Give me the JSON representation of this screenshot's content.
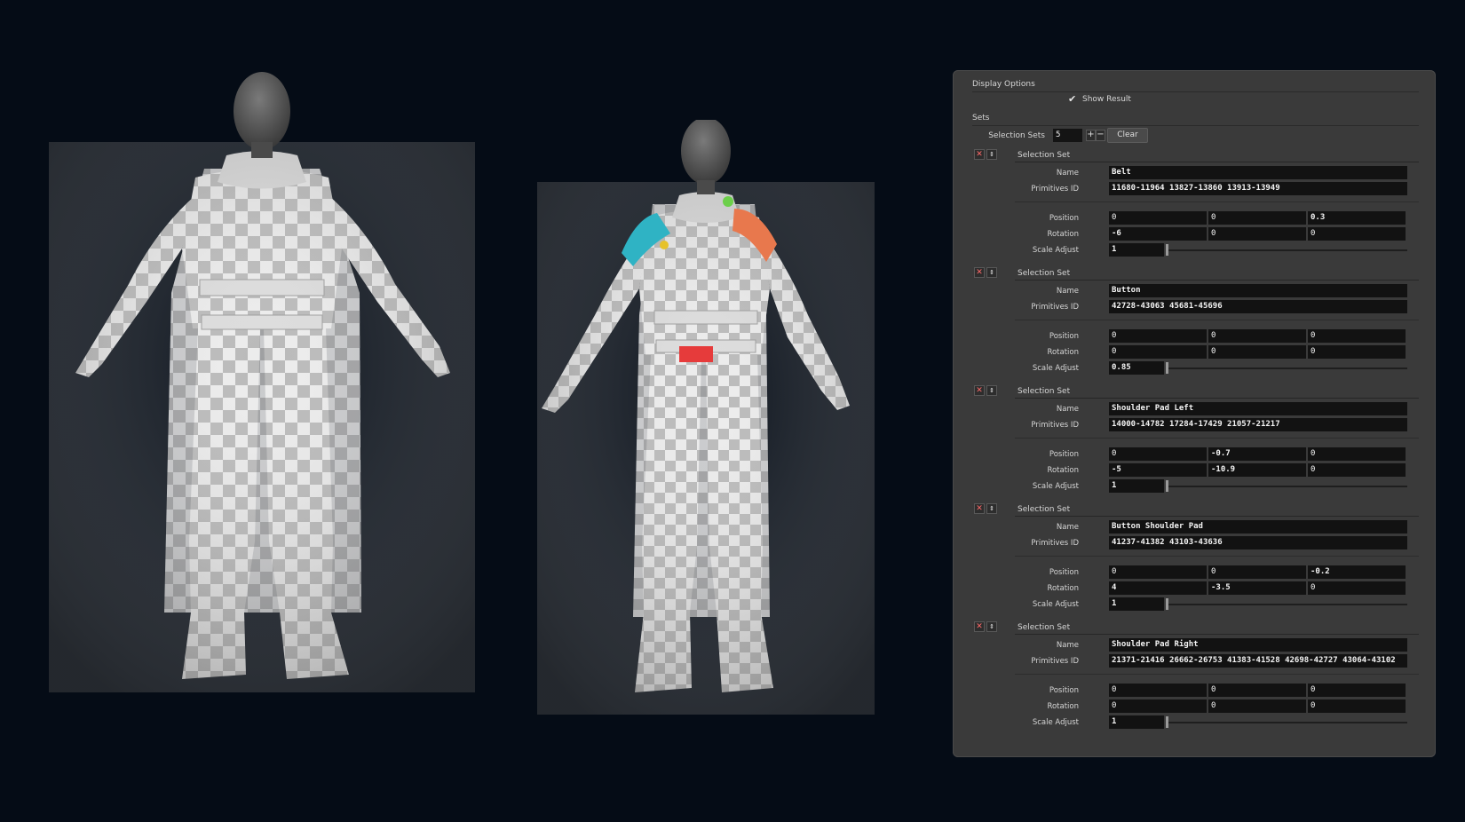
{
  "panel": {
    "display_options_label": "Display Options",
    "show_result_label": "Show Result",
    "show_result_checked": true,
    "sets_label": "Sets",
    "selection_sets_label": "Selection Sets",
    "selection_sets_count": "5",
    "plus_label": "+",
    "minus_label": "−",
    "clear_label": "Clear",
    "labels": {
      "selection_set": "Selection Set",
      "name": "Name",
      "primitives_id": "Primitives ID",
      "position": "Position",
      "rotation": "Rotation",
      "scale_adjust": "Scale Adjust"
    },
    "sets": [
      {
        "name": "Belt",
        "primitives": "11680-11964 13827-13860 13913-13949",
        "position": [
          "0",
          "0",
          "0.3"
        ],
        "rotation": [
          "-6",
          "0",
          "0"
        ],
        "scale": "1",
        "scale_fraction": 0.0
      },
      {
        "name": "Button",
        "primitives": "42728-43063 45681-45696",
        "position": [
          "0",
          "0",
          "0"
        ],
        "rotation": [
          "0",
          "0",
          "0"
        ],
        "scale": "0.85",
        "scale_fraction": 0.0
      },
      {
        "name": "Shoulder Pad Left",
        "primitives": "14000-14782 17284-17429 21057-21217",
        "position": [
          "0",
          "-0.7",
          "0"
        ],
        "rotation": [
          "-5",
          "-10.9",
          "0"
        ],
        "scale": "1",
        "scale_fraction": 0.0
      },
      {
        "name": "Button Shoulder Pad",
        "primitives": "41237-41382 43103-43636",
        "position": [
          "0",
          "0",
          "-0.2"
        ],
        "rotation": [
          "4",
          "-3.5",
          "0"
        ],
        "scale": "1",
        "scale_fraction": 0.0
      },
      {
        "name": "Shoulder Pad Right",
        "primitives": "21371-21416 26662-26753 41383-41528 42698-42727 43064-43102",
        "position": [
          "0",
          "0",
          "0"
        ],
        "rotation": [
          "0",
          "0",
          "0"
        ],
        "scale": "1",
        "scale_fraction": 0.0
      }
    ]
  },
  "viewport": {
    "background_color": "#050c16",
    "body_color": "#e9e9e9",
    "head_color": "#5a5a5a",
    "highlight_colors": {
      "shoulder_pad_left": "#e8784d",
      "shoulder_pad_right": "#2fb3c4",
      "belt_buckle": "#e63b3b",
      "button": "#e6c22a",
      "button_shoulder_pad": "#6ccf4a"
    }
  }
}
